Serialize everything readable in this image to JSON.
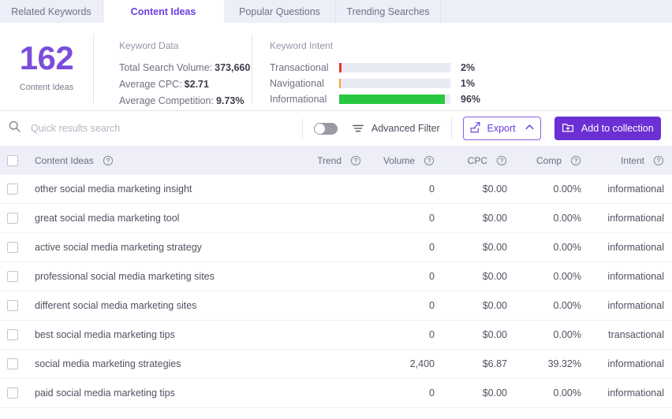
{
  "tabs": [
    {
      "label": "Related Keywords",
      "active": false
    },
    {
      "label": "Content Ideas",
      "active": true
    },
    {
      "label": "Popular Questions",
      "active": false
    },
    {
      "label": "Trending Searches",
      "active": false
    }
  ],
  "summary": {
    "count": "162",
    "count_label": "Content Ideas",
    "keyword_data": {
      "title": "Keyword Data",
      "rows": [
        {
          "label": "Total Search Volume:",
          "value": "373,660"
        },
        {
          "label": "Average CPC:",
          "value": "$2.71"
        },
        {
          "label": "Average Competition:",
          "value": "9.73%"
        }
      ]
    },
    "keyword_intent": {
      "title": "Keyword Intent",
      "rows": [
        {
          "name": "Transactional",
          "pct": "2%",
          "width": 2,
          "color": "#e8382b"
        },
        {
          "name": "Navigational",
          "pct": "1%",
          "width": 1.5,
          "color": "#f5a623"
        },
        {
          "name": "Informational",
          "pct": "96%",
          "width": 95,
          "color": "#27c840"
        }
      ]
    }
  },
  "toolbar": {
    "search_placeholder": "Quick results search",
    "search_value": "",
    "advanced_filter": "Advanced Filter",
    "export": "Export",
    "add_to_collection": "Add to collection"
  },
  "table": {
    "columns": {
      "keyword": "Content Ideas",
      "trend": "Trend",
      "volume": "Volume",
      "cpc": "CPC",
      "comp": "Comp",
      "intent": "Intent"
    },
    "rows": [
      {
        "keyword": "other social media marketing insight",
        "trend": "",
        "volume": "0",
        "cpc": "$0.00",
        "comp": "0.00%",
        "intent": "informational"
      },
      {
        "keyword": "great social media marketing tool",
        "trend": "",
        "volume": "0",
        "cpc": "$0.00",
        "comp": "0.00%",
        "intent": "informational"
      },
      {
        "keyword": "active social media marketing strategy",
        "trend": "",
        "volume": "0",
        "cpc": "$0.00",
        "comp": "0.00%",
        "intent": "informational"
      },
      {
        "keyword": "professional social media marketing sites",
        "trend": "",
        "volume": "0",
        "cpc": "$0.00",
        "comp": "0.00%",
        "intent": "informational"
      },
      {
        "keyword": "different social media marketing sites",
        "trend": "",
        "volume": "0",
        "cpc": "$0.00",
        "comp": "0.00%",
        "intent": "informational"
      },
      {
        "keyword": "best social media marketing tips",
        "trend": "",
        "volume": "0",
        "cpc": "$0.00",
        "comp": "0.00%",
        "intent": "transactional"
      },
      {
        "keyword": "social media marketing strategies",
        "trend": "",
        "volume": "2,400",
        "cpc": "$6.87",
        "comp": "39.32%",
        "intent": "informational"
      },
      {
        "keyword": "paid social media marketing tips",
        "trend": "",
        "volume": "0",
        "cpc": "$0.00",
        "comp": "0.00%",
        "intent": "informational"
      }
    ]
  },
  "colors": {
    "accent": "#6c3fe0",
    "accent_fill": "#6c2fd4",
    "tabstrip": "#eceef8",
    "header_row": "#edeef7"
  }
}
